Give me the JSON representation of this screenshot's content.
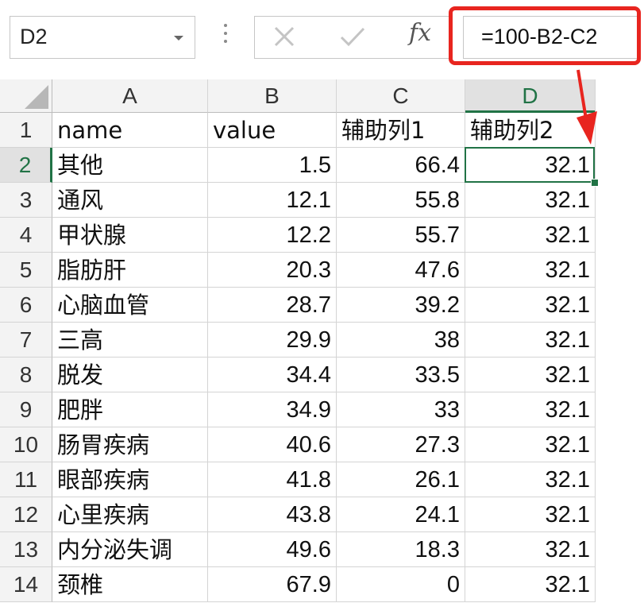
{
  "formula_bar": {
    "name_box": "D2",
    "formula": "=100-B2-C2",
    "fx_label": "fx"
  },
  "highlight_color": "#e8251f",
  "selection_color": "#217346",
  "sheet": {
    "columns": [
      "A",
      "B",
      "C",
      "D"
    ],
    "selected_column": "D",
    "selected_row": "2",
    "rows": [
      {
        "num": "1",
        "cells": [
          "name",
          "value",
          "辅助列1",
          "辅助列2"
        ]
      },
      {
        "num": "2",
        "cells": [
          "其他",
          "1.5",
          "66.4",
          "32.1"
        ]
      },
      {
        "num": "3",
        "cells": [
          "通风",
          "12.1",
          "55.8",
          "32.1"
        ]
      },
      {
        "num": "4",
        "cells": [
          "甲状腺",
          "12.2",
          "55.7",
          "32.1"
        ]
      },
      {
        "num": "5",
        "cells": [
          "脂肪肝",
          "20.3",
          "47.6",
          "32.1"
        ]
      },
      {
        "num": "6",
        "cells": [
          "心脑血管",
          "28.7",
          "39.2",
          "32.1"
        ]
      },
      {
        "num": "7",
        "cells": [
          "三高",
          "29.9",
          "38",
          "32.1"
        ]
      },
      {
        "num": "8",
        "cells": [
          "脱发",
          "34.4",
          "33.5",
          "32.1"
        ]
      },
      {
        "num": "9",
        "cells": [
          "肥胖",
          "34.9",
          "33",
          "32.1"
        ]
      },
      {
        "num": "10",
        "cells": [
          "肠胃疾病",
          "40.6",
          "27.3",
          "32.1"
        ]
      },
      {
        "num": "11",
        "cells": [
          "眼部疾病",
          "41.8",
          "26.1",
          "32.1"
        ]
      },
      {
        "num": "12",
        "cells": [
          "心里疾病",
          "43.8",
          "24.1",
          "32.1"
        ]
      },
      {
        "num": "13",
        "cells": [
          "内分泌失调",
          "49.6",
          "18.3",
          "32.1"
        ]
      },
      {
        "num": "14",
        "cells": [
          "颈椎",
          "67.9",
          "0",
          "32.1"
        ]
      }
    ]
  }
}
